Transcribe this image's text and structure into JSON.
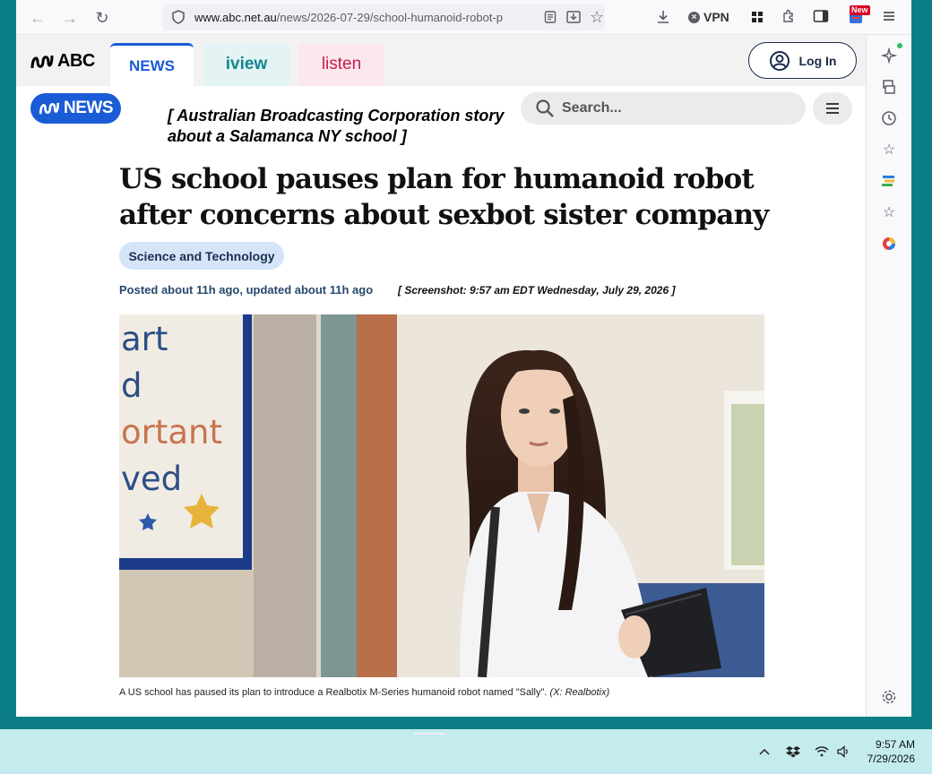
{
  "browser": {
    "url_domain": "www.abc.net.au",
    "url_path": "/news/2026-07-29/school-humanoid-robot-p",
    "vpn_label": "VPN",
    "new_badge": "New"
  },
  "abc_nav": {
    "logo_text": "ABC",
    "tabs": [
      {
        "label": "NEWS",
        "active": true,
        "color": "#1a5bd6"
      },
      {
        "label": "iview",
        "active": false,
        "color": "#14868f"
      },
      {
        "label": "listen",
        "active": false,
        "color": "#c81b48"
      }
    ],
    "login_label": "Log In"
  },
  "article": {
    "news_logo_text": "NEWS",
    "annotation": "[ Australian Broadcasting Corporation story about a Salamanca NY school ]",
    "search_placeholder": "Search...",
    "headline": "US school pauses plan for humanoid robot after concerns about sexbot sister company",
    "topic": "Science and Technology",
    "byline": "Posted about 11h ago, updated about 11h ago",
    "screenshot_note": "[ Screenshot: 9:57 am EDT Wednesday, July 29, 2026 ]",
    "classroom_poster_lines": [
      "art",
      "d",
      "ortant",
      "ved"
    ],
    "caption": "A US school has paused its plan to introduce a Realbotix M-Series humanoid robot named \"Sally\".",
    "caption_credit": "(X: Realbotix)"
  },
  "taskbar": {
    "time": "9:57 AM",
    "date": "7/29/2026"
  },
  "colors": {
    "abc_blue": "#1a5bd6",
    "desktop_teal": "#0c7f86",
    "taskbar_bg": "#c4ebee"
  }
}
